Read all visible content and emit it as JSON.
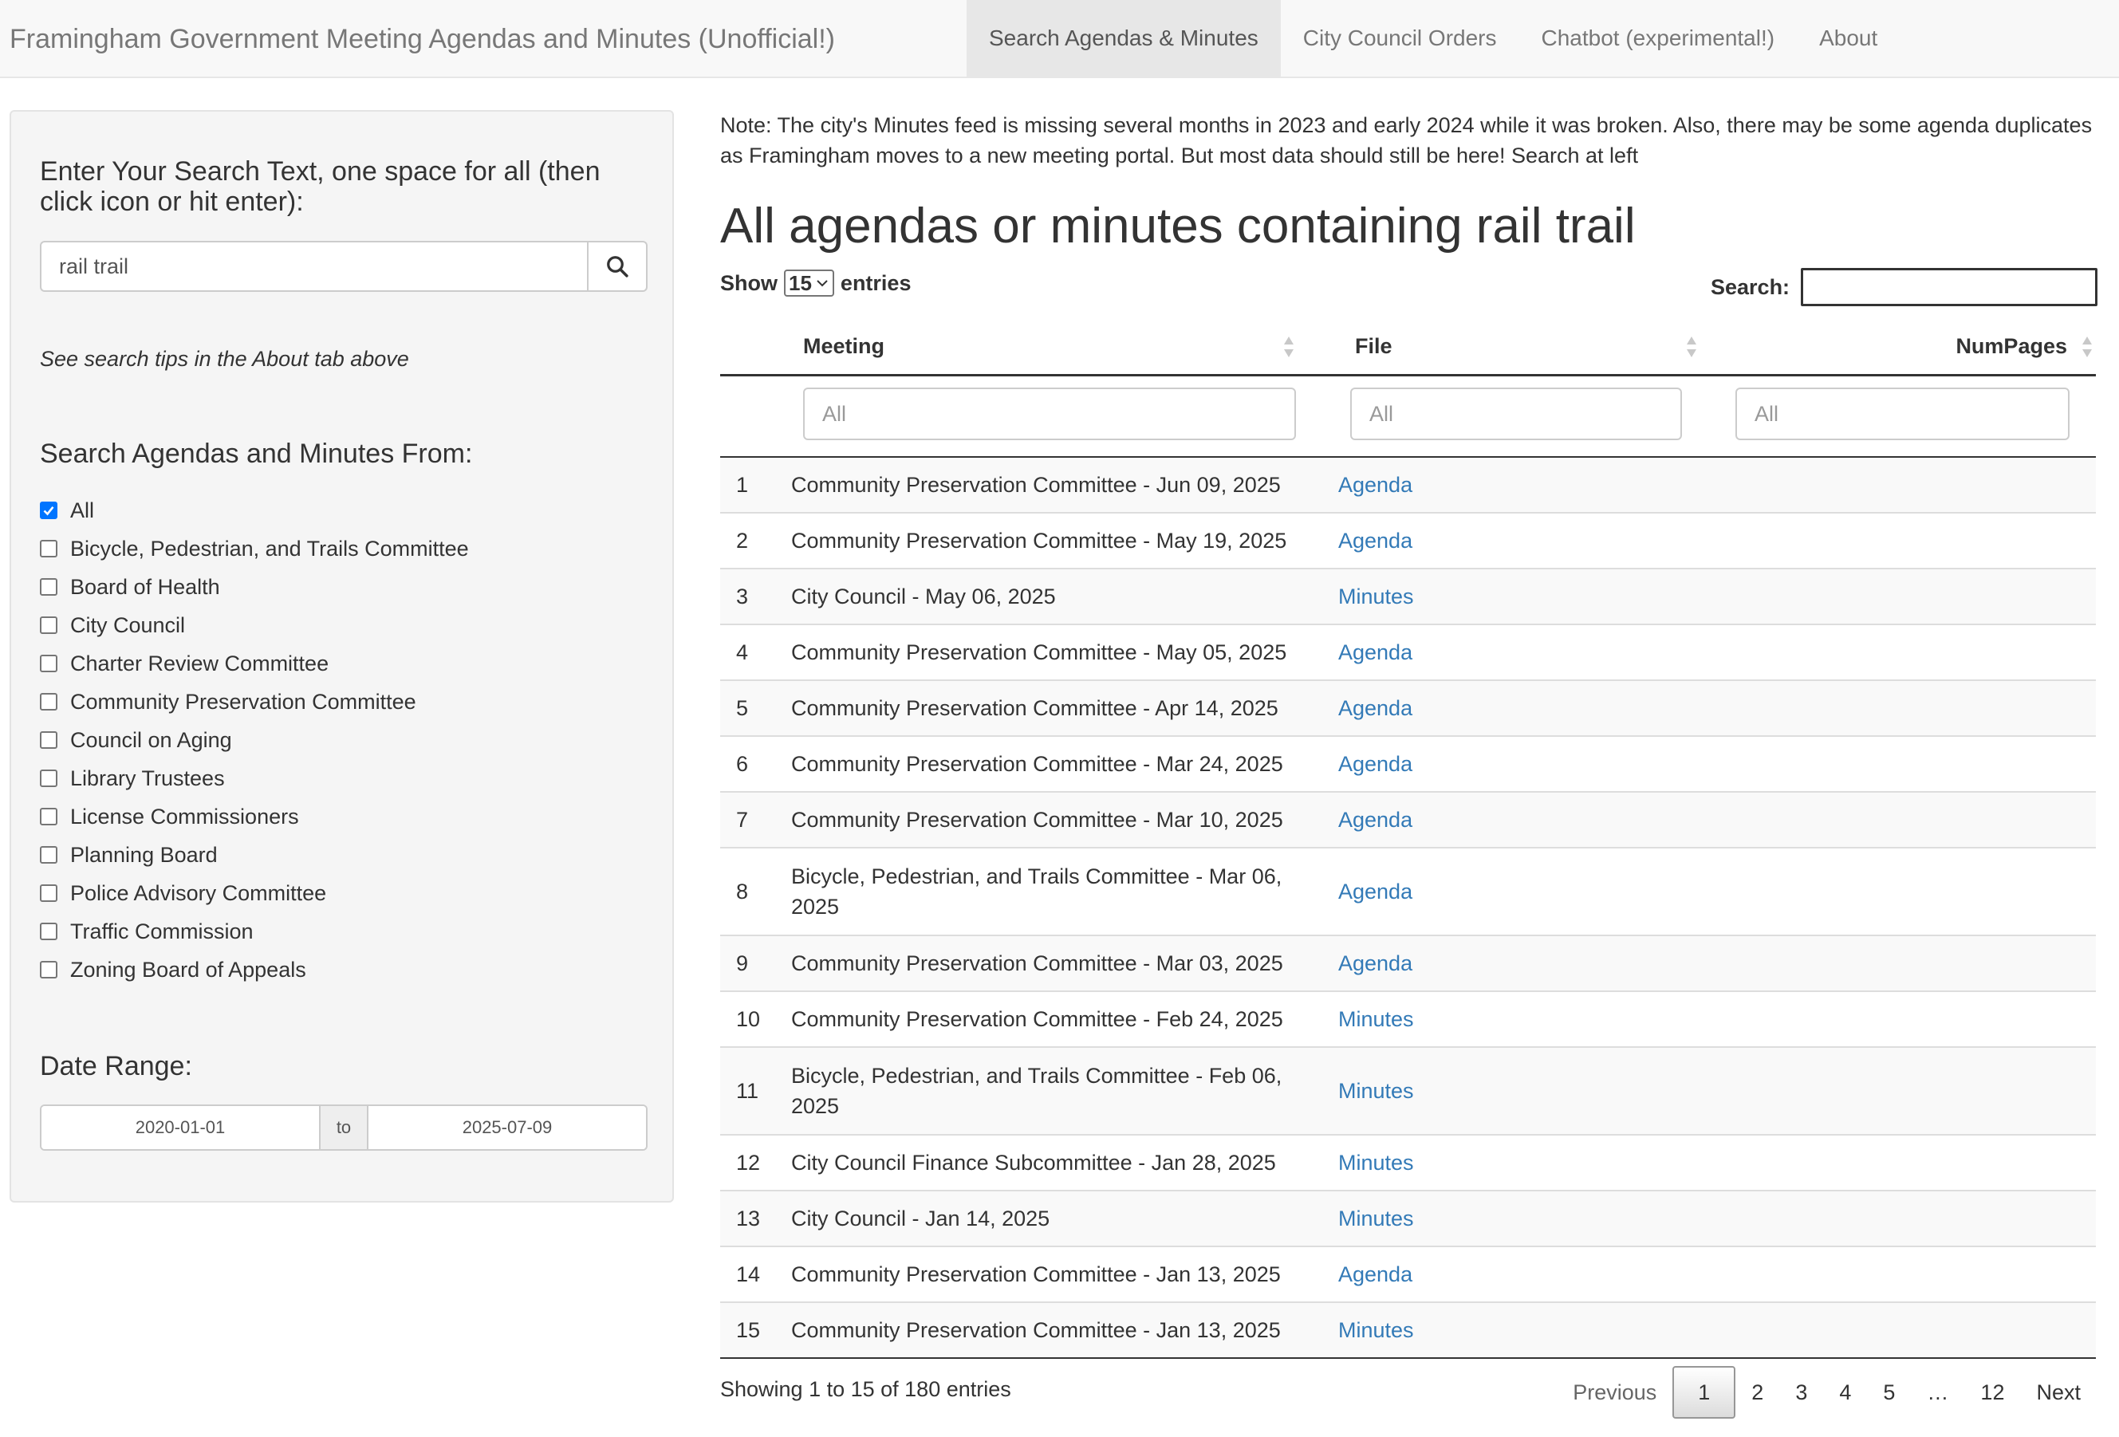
{
  "navbar": {
    "brand": "Framingham Government Meeting Agendas and Minutes (Unofficial!)",
    "tabs": [
      {
        "label": "Search Agendas & Minutes",
        "active": true
      },
      {
        "label": "City Council Orders",
        "active": false
      },
      {
        "label": "Chatbot (experimental!)",
        "active": false
      },
      {
        "label": "About",
        "active": false
      }
    ]
  },
  "sidebar": {
    "search_label": "Enter Your Search Text, one space for all (then click icon or hit enter):",
    "search_value": "rail trail",
    "search_icon": "search-icon",
    "tips": "See search tips in the About tab above",
    "sources_label": "Search Agendas and Minutes From:",
    "sources": [
      {
        "label": "All",
        "checked": true
      },
      {
        "label": "Bicycle, Pedestrian, and Trails Committee",
        "checked": false
      },
      {
        "label": "Board of Health",
        "checked": false
      },
      {
        "label": "City Council",
        "checked": false
      },
      {
        "label": "Charter Review Committee",
        "checked": false
      },
      {
        "label": "Community Preservation Committee",
        "checked": false
      },
      {
        "label": "Council on Aging",
        "checked": false
      },
      {
        "label": "Library Trustees",
        "checked": false
      },
      {
        "label": "License Commissioners",
        "checked": false
      },
      {
        "label": "Planning Board",
        "checked": false
      },
      {
        "label": "Police Advisory Committee",
        "checked": false
      },
      {
        "label": "Traffic Commission",
        "checked": false
      },
      {
        "label": "Zoning Board of Appeals",
        "checked": false
      }
    ],
    "date_label": "Date Range:",
    "date_start": "2020-01-01",
    "date_sep": "to",
    "date_end": "2025-07-09"
  },
  "main": {
    "note": "Note: The city's Minutes feed is missing several months in 2023 and early 2024 while it was broken. Also, there may be some agenda duplicates as Framingham moves to a new meeting portal. But most data should still be here! Search at left",
    "title": "All agendas or minutes containing rail trail",
    "show_label": "Show",
    "show_value": "15",
    "entries_label": "entries",
    "search_label": "Search:",
    "columns": [
      "Meeting",
      "File",
      "NumPages"
    ],
    "filter_placeholder": "All",
    "rows": [
      {
        "num": "1",
        "meeting": "Community Preservation Committee - Jun 09, 2025",
        "file": "Agenda"
      },
      {
        "num": "2",
        "meeting": "Community Preservation Committee - May 19, 2025",
        "file": "Agenda"
      },
      {
        "num": "3",
        "meeting": "City Council - May 06, 2025",
        "file": "Minutes"
      },
      {
        "num": "4",
        "meeting": "Community Preservation Committee - May 05, 2025",
        "file": "Agenda"
      },
      {
        "num": "5",
        "meeting": "Community Preservation Committee - Apr 14, 2025",
        "file": "Agenda"
      },
      {
        "num": "6",
        "meeting": "Community Preservation Committee - Mar 24, 2025",
        "file": "Agenda"
      },
      {
        "num": "7",
        "meeting": "Community Preservation Committee - Mar 10, 2025",
        "file": "Agenda"
      },
      {
        "num": "8",
        "meeting": "Bicycle, Pedestrian, and Trails Committee - Mar 06, 2025",
        "file": "Agenda"
      },
      {
        "num": "9",
        "meeting": "Community Preservation Committee - Mar 03, 2025",
        "file": "Agenda"
      },
      {
        "num": "10",
        "meeting": "Community Preservation Committee - Feb 24, 2025",
        "file": "Minutes"
      },
      {
        "num": "11",
        "meeting": "Bicycle, Pedestrian, and Trails Committee - Feb 06, 2025",
        "file": "Minutes"
      },
      {
        "num": "12",
        "meeting": "City Council Finance Subcommittee - Jan 28, 2025",
        "file": "Minutes"
      },
      {
        "num": "13",
        "meeting": "City Council - Jan 14, 2025",
        "file": "Minutes"
      },
      {
        "num": "14",
        "meeting": "Community Preservation Committee - Jan 13, 2025",
        "file": "Agenda"
      },
      {
        "num": "15",
        "meeting": "Community Preservation Committee - Jan 13, 2025",
        "file": "Minutes"
      }
    ],
    "info": "Showing 1 to 15 of 180 entries",
    "pagination": {
      "previous": "Previous",
      "pages": [
        "1",
        "2",
        "3",
        "4",
        "5",
        "…",
        "12"
      ],
      "current": "1",
      "next": "Next"
    }
  },
  "colors": {
    "link": "#337ab7",
    "checkbox": "#0075ff",
    "nav_active": "#e7e7e7"
  }
}
